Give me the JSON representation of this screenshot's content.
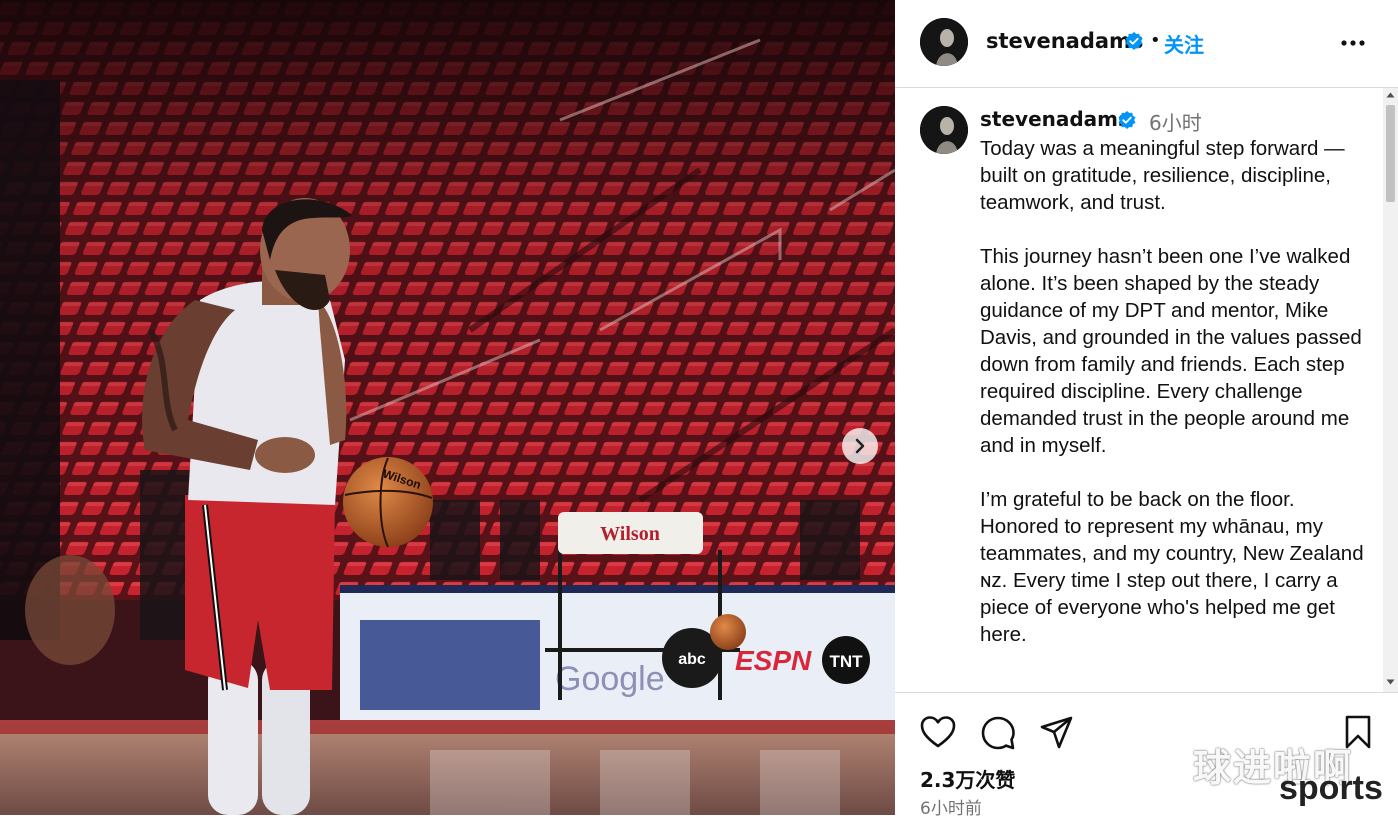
{
  "header": {
    "username": "stevenadams",
    "separator": "•",
    "follow_label": "关注"
  },
  "caption": {
    "username": "stevenadams",
    "time_ago": "6小时",
    "text": "Today was a meaningful step forward —built on gratitude, resilience, discipline, teamwork, and trust.\n\nThis journey hasn’t been one I’ve walked alone. It’s been shaped by the steady guidance of my DPT and mentor, Mike Davis, and grounded in the values passed down from family and friends. Each step required discipline. Every challenge demanded trust in the people around me and in myself.\n\nI’m grateful to be back on the floor. Honored to represent my whānau, my teammates, and my country, New Zealand ɴᴢ. Every time I step out there, I carry a piece of everyone who's helped me get here."
  },
  "footer": {
    "likes": "2.3万次赞",
    "post_time": "6小时前"
  },
  "photo": {
    "ball_brand": "Wilson",
    "courtside_sign": "Wilson",
    "ad_text_google": "Google",
    "ad_text_espn": "ESPN",
    "ad_text_tnt": "TNT",
    "ad_text_abc": "abc"
  },
  "watermark": {
    "chinese": "球进啦啊",
    "english": "sports"
  },
  "colors": {
    "link_blue": "#0095f6",
    "verified_blue": "#0095f6",
    "divider": "#dbdbdb",
    "secondary_text": "#737373",
    "seat_red": "#c4222f"
  },
  "icons": {
    "verified": "verified-badge-icon",
    "more": "more-horizontal-icon",
    "next": "chevron-right-icon",
    "like": "heart-icon",
    "comment": "comment-icon",
    "share": "share-icon",
    "save": "bookmark-icon"
  }
}
